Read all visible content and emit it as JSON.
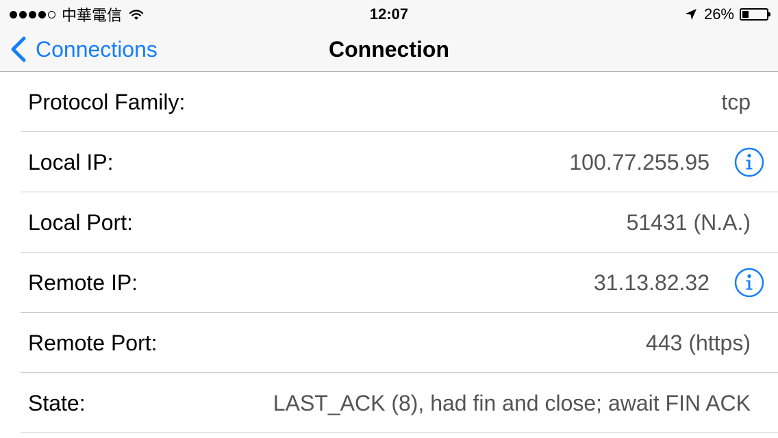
{
  "status_bar": {
    "signal_dots_filled": 4,
    "signal_dots_total": 5,
    "carrier": "中華電信",
    "time": "12:07",
    "battery_percent_label": "26%",
    "battery_level": 0.26,
    "icons": [
      "wifi-icon",
      "location-arrow-icon",
      "battery-icon"
    ]
  },
  "nav": {
    "back_label": "Connections",
    "title": "Connection"
  },
  "rows": [
    {
      "label": "Protocol Family:",
      "value": "tcp",
      "info": false
    },
    {
      "label": "Local IP:",
      "value": "100.77.255.95",
      "info": true
    },
    {
      "label": "Local Port:",
      "value": "51431 (N.A.)",
      "info": false
    },
    {
      "label": "Remote IP:",
      "value": "31.13.82.32",
      "info": true
    },
    {
      "label": "Remote Port:",
      "value": "443 (https)",
      "info": false
    },
    {
      "label": "State:",
      "value": "LAST_ACK (8), had fin and close; await FIN ACK",
      "info": false
    }
  ],
  "colors": {
    "accent": "#157efb",
    "value_text": "#545454",
    "separator": "#c8c7cc",
    "nav_background": "#f7f7f7"
  }
}
